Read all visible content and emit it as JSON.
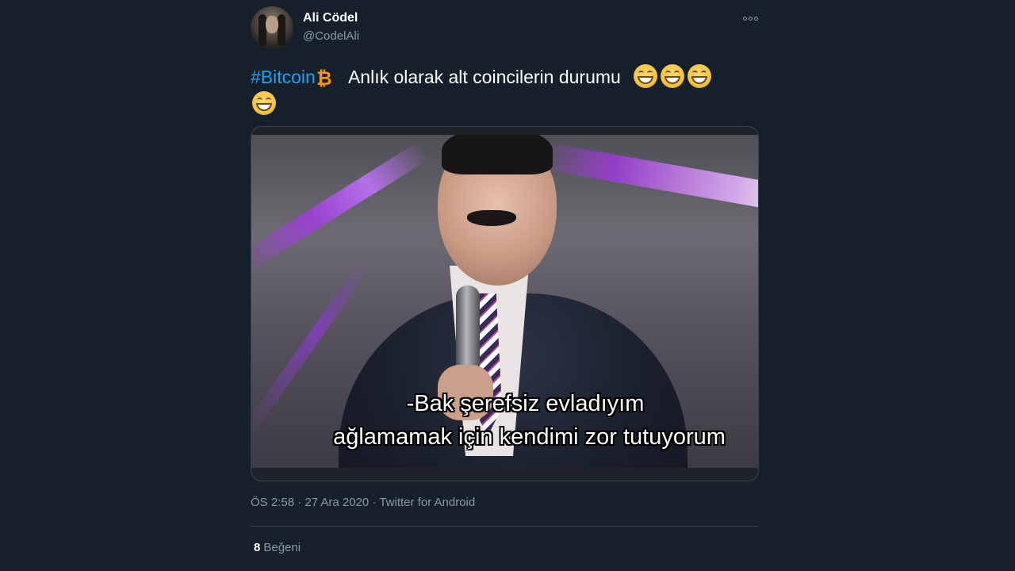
{
  "user": {
    "name": "Ali Cödel",
    "handle": "@CodelAli"
  },
  "tweet": {
    "hashtag": "#Bitcoin",
    "bitcoin_symbol": "₿",
    "text": " Anlık olarak alt coincilerin durumu",
    "emoji": "grinning-face-with-smiling-eyes",
    "emoji_count": 4
  },
  "media": {
    "subtitle_line1": "-Bak şerefsiz evladıyım",
    "subtitle_line2": "ağlamamak için kendimi zor tutuyorum"
  },
  "meta": {
    "timestamp": "ÖS 2:58 · 27 Ara 2020 · Twitter for Android"
  },
  "stats": {
    "likes_count": "8",
    "likes_label": "Beğeni"
  },
  "colors": {
    "background": "#15202b",
    "link": "#1da1f2",
    "secondary_text": "#8899a6",
    "bitcoin": "#f7931a"
  },
  "icons": {
    "more": "more-options-icon",
    "bitcoin": "bitcoin-icon"
  }
}
